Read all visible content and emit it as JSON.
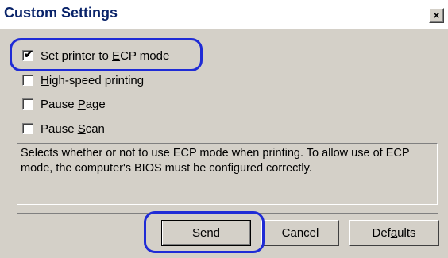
{
  "window": {
    "title": "Custom Settings",
    "close_symbol": "×"
  },
  "options": [
    {
      "pre": "Set printer to ",
      "accel": "E",
      "post": "CP mode",
      "checked": true
    },
    {
      "pre": "",
      "accel": "H",
      "post": "igh-speed printing",
      "checked": false
    },
    {
      "pre": "Pause ",
      "accel": "P",
      "post": "age",
      "checked": false
    },
    {
      "pre": "Pause ",
      "accel": "S",
      "post": "can",
      "checked": false
    }
  ],
  "description": "Selects whether or not to use ECP mode when printing. To allow use of ECP mode, the computer's BIOS must be configured correctly.",
  "buttons": {
    "send": "Send",
    "cancel": "Cancel",
    "defaults_pre": "Def",
    "defaults_accel": "a",
    "defaults_post": "ults"
  },
  "check_symbol": "✔",
  "highlight_color": "#1f2bd6"
}
